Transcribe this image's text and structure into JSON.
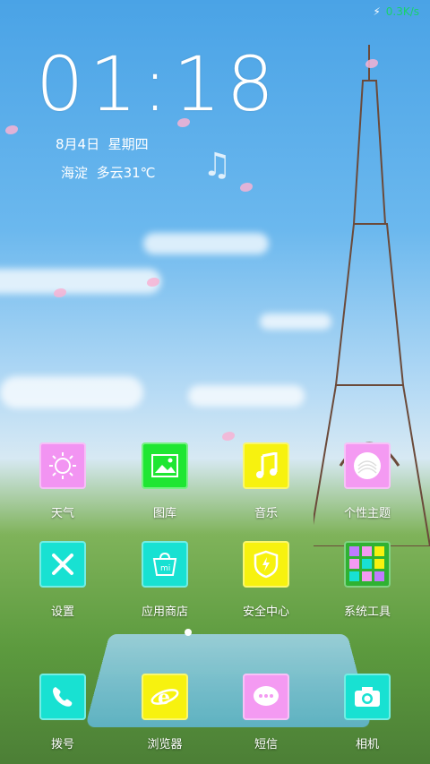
{
  "status_bar": {
    "network_speed": "0.3K/s",
    "charging_icon": "lightning-icon"
  },
  "clock": {
    "time": "01:18",
    "date": "8月4日",
    "weekday": "星期四",
    "location": "海淀",
    "weather": "多云31℃"
  },
  "home": {
    "apps": [
      {
        "label": "天气",
        "icon": "sun-icon",
        "color": "#f294f2"
      },
      {
        "label": "图库",
        "icon": "picture-icon",
        "color": "#1fe632"
      },
      {
        "label": "音乐",
        "icon": "music-note-icon",
        "color": "#f7f20f"
      },
      {
        "label": "个性主题",
        "icon": "theme-icon",
        "color": "#f49af2"
      },
      {
        "label": "设置",
        "icon": "tools-icon",
        "color": "#18e1d2"
      },
      {
        "label": "应用商店",
        "icon": "shopping-bag-icon",
        "color": "#18e1d2"
      },
      {
        "label": "安全中心",
        "icon": "shield-icon",
        "color": "#f7f20f"
      },
      {
        "label": "系统工具",
        "icon": "folder-grid-icon",
        "color": "#2fb232"
      }
    ],
    "dock": [
      {
        "label": "拨号",
        "icon": "phone-icon",
        "color": "#18e1d2"
      },
      {
        "label": "浏览器",
        "icon": "browser-e-icon",
        "color": "#f7f20f"
      },
      {
        "label": "短信",
        "icon": "message-icon",
        "color": "#f49af2"
      },
      {
        "label": "相机",
        "icon": "camera-icon",
        "color": "#18e1d2"
      }
    ]
  }
}
